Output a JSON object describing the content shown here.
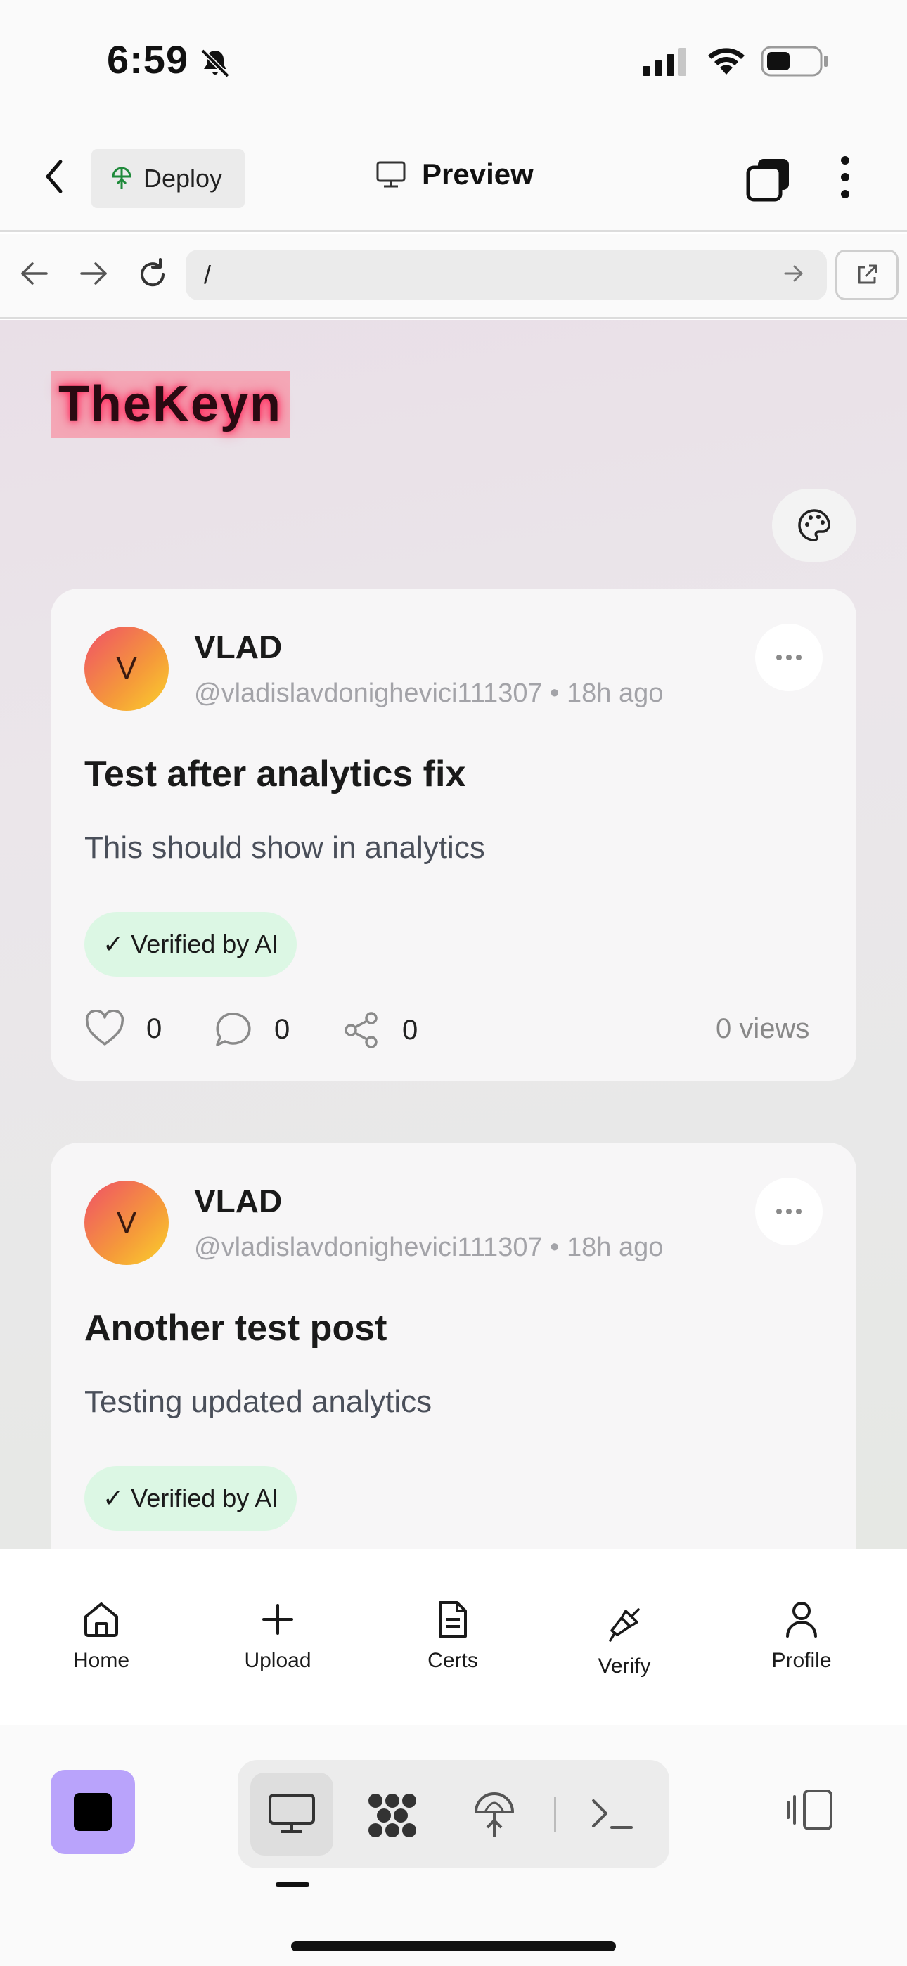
{
  "status_bar": {
    "time": "6:59"
  },
  "header": {
    "deploy_label": "Deploy",
    "preview_label": "Preview"
  },
  "url_bar": {
    "url": "/"
  },
  "site": {
    "logo_text": "TheKeyn"
  },
  "posts": [
    {
      "avatar_letter": "V",
      "author": "VLAD",
      "handle": "@vladislavdonighevici111307 • 18h ago",
      "title": "Test after analytics fix",
      "body": "This should show in analytics",
      "badge": "✓ Verified by AI",
      "likes": "0",
      "comments": "0",
      "shares": "0",
      "views": "0 views"
    },
    {
      "avatar_letter": "V",
      "author": "VLAD",
      "handle": "@vladislavdonighevici111307 • 18h ago",
      "title": "Another test post",
      "body": "Testing updated analytics",
      "badge": "✓ Verified by AI"
    }
  ],
  "tabbar": {
    "items": [
      {
        "label": "Home",
        "icon": "home-icon"
      },
      {
        "label": "Upload",
        "icon": "plus-icon"
      },
      {
        "label": "Certs",
        "icon": "document-icon"
      },
      {
        "label": "Verify",
        "icon": "brush-icon"
      },
      {
        "label": "Profile",
        "icon": "user-icon"
      }
    ]
  },
  "colors": {
    "accent_purple": "#b9a3fb",
    "verified_badge": "#dcf7e4",
    "logo_glow": "#ff1f54"
  }
}
